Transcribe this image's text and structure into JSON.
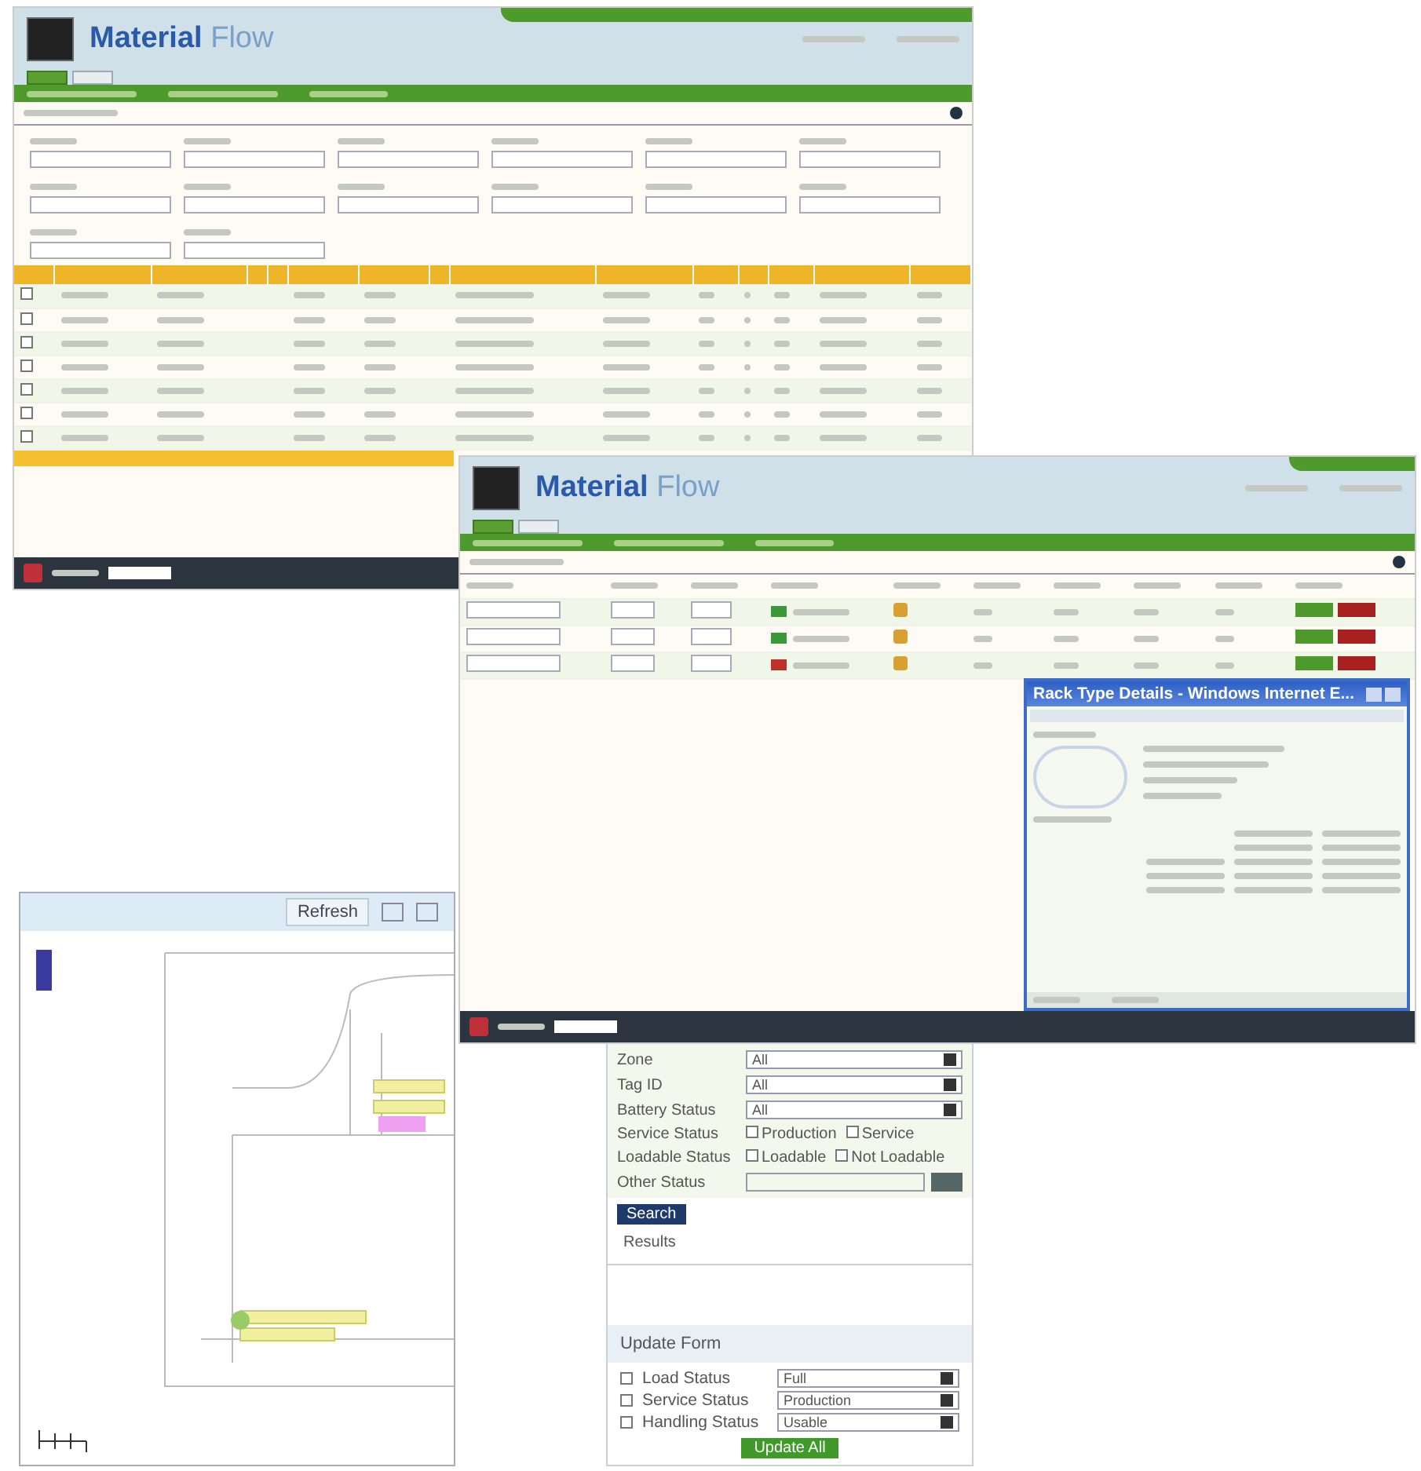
{
  "report_window": {
    "app_title": {
      "bold": "Material",
      "light": "Flow"
    },
    "tabs": [
      {
        "selected": true
      },
      {
        "selected": false
      }
    ],
    "rows": [
      {
        "checked": false
      },
      {
        "checked": false
      },
      {
        "checked": false
      },
      {
        "checked": false
      },
      {
        "checked": false
      },
      {
        "checked": false
      },
      {
        "checked": false
      }
    ]
  },
  "kanban_window": {
    "app_title": {
      "bold": "Material",
      "light": "Flow"
    },
    "tabs": [
      {
        "selected": true
      },
      {
        "selected": false
      }
    ],
    "rows": [
      {
        "color": "#3a9a3a"
      },
      {
        "color": "#3a9a3a"
      },
      {
        "color": "#c0302a"
      }
    ]
  },
  "details_dialog": {
    "title": "Rack Type Details - Windows Internet E..."
  },
  "map_panel": {
    "refresh_button": "Refresh"
  },
  "filter_panel": {
    "fields": [
      {
        "kind": "select",
        "label": "Zone",
        "value": "All"
      },
      {
        "kind": "select",
        "label": "Tag ID",
        "value": "All"
      },
      {
        "kind": "select",
        "label": "Battery Status",
        "value": "All"
      },
      {
        "kind": "checks",
        "label": "Service Status",
        "options": [
          {
            "label": "Production",
            "checked": false
          },
          {
            "label": "Service",
            "checked": false
          }
        ]
      },
      {
        "kind": "checks",
        "label": "Loadable Status",
        "options": [
          {
            "label": "Loadable",
            "checked": false
          },
          {
            "label": "Not Loadable",
            "checked": false
          }
        ]
      },
      {
        "kind": "text",
        "label": "Other Status"
      }
    ],
    "search_button": "Search",
    "results_label": "Results",
    "update_form": {
      "title": "Update Form",
      "rows": [
        {
          "label": "Load Status",
          "value": "Full",
          "checked": false
        },
        {
          "label": "Service Status",
          "value": "Production",
          "checked": false
        },
        {
          "label": "Handling Status",
          "value": "Usable",
          "checked": false
        }
      ],
      "button": "Update All"
    }
  }
}
